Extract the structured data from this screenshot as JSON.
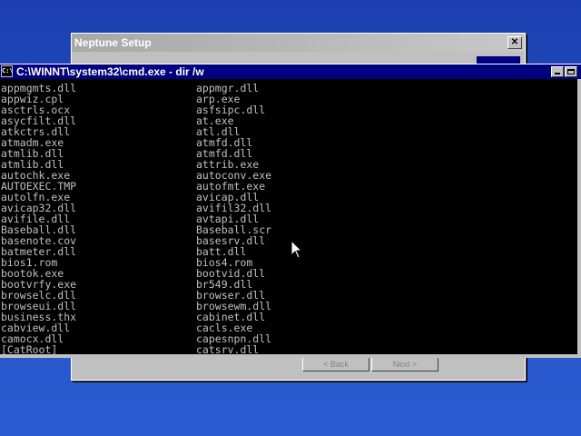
{
  "setup_window": {
    "title": "Neptune Setup",
    "close_glyph": "✕",
    "buttons": [
      "< Back",
      "Next >"
    ]
  },
  "cmd_window": {
    "title": "C:\\WINNT\\system32\\cmd.exe - dir /w",
    "icon_text": "C:\\"
  },
  "listing": [
    [
      "appmgmts.dll",
      "appmgr.dll"
    ],
    [
      "appwiz.cpl",
      "arp.exe"
    ],
    [
      "asctrls.ocx",
      "asfsipc.dll"
    ],
    [
      "asycfilt.dll",
      "at.exe"
    ],
    [
      "atkctrs.dll",
      "atl.dll"
    ],
    [
      "atmadm.exe",
      "atmfd.dll"
    ],
    [
      "atmlib.dll",
      "atmfd.dll"
    ],
    [
      "atmlib.dll",
      "attrib.exe"
    ],
    [
      "autochk.exe",
      "autoconv.exe"
    ],
    [
      "AUTOEXEC.TMP",
      "autofmt.exe"
    ],
    [
      "autolfn.exe",
      "avicap.dll"
    ],
    [
      "avicap32.dll",
      "avifil32.dll"
    ],
    [
      "avifile.dll",
      "avtapi.dll"
    ],
    [
      "Baseball.dll",
      "Baseball.scr"
    ],
    [
      "basenote.cov",
      "basesrv.dll"
    ],
    [
      "batmeter.dll",
      "batt.dll"
    ],
    [
      "bios1.rom",
      "bios4.rom"
    ],
    [
      "bootok.exe",
      "bootvid.dll"
    ],
    [
      "bootvrfy.exe",
      "br549.dll"
    ],
    [
      "browselc.dll",
      "browser.dll"
    ],
    [
      "browseui.dll",
      "browsewm.dll"
    ],
    [
      "business.thx",
      "cabinet.dll"
    ],
    [
      "cabview.dll",
      "cacls.exe"
    ],
    [
      "camocx.dll",
      "capesnpn.dll"
    ],
    [
      "[CatRoot]",
      "catsrv.dll"
    ]
  ]
}
